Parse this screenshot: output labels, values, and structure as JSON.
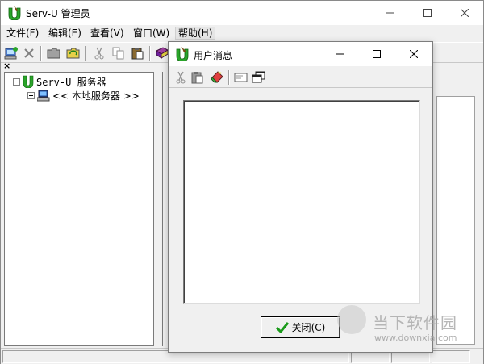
{
  "window": {
    "title": "Serv-U 管理员",
    "minimize_glyph": "—",
    "maximize_glyph": "☐",
    "close_glyph": "✕"
  },
  "menu": [
    {
      "label": "文件(F)"
    },
    {
      "label": "编辑(E)"
    },
    {
      "label": "查看(V)"
    },
    {
      "label": "窗口(W)"
    },
    {
      "label": "帮助(H)"
    }
  ],
  "toolbar": {
    "icons": [
      "connect-icon",
      "disconnect-icon",
      "folder-icon",
      "refresh-folder-icon",
      "cut-icon",
      "copy-icon",
      "paste-icon",
      "book-icon"
    ]
  },
  "tree": {
    "pane_close": "×",
    "root": {
      "label": "Serv-U 服务器",
      "expander": "-"
    },
    "child": {
      "label": "<< 本地服务器 >>",
      "expander": "+"
    }
  },
  "dialog": {
    "title": "用户消息",
    "toolbar_icons": [
      "cut-icon",
      "paste-icon",
      "eraser-icon",
      "message-icon",
      "windows-icon"
    ],
    "content_text": "",
    "close_button": "关闭(C)"
  },
  "watermark": {
    "text": "当下软件园",
    "url": "www.downxia.com"
  },
  "colors": {
    "accent_green": "#2aa52a",
    "window_bg": "#f0f0f0"
  }
}
